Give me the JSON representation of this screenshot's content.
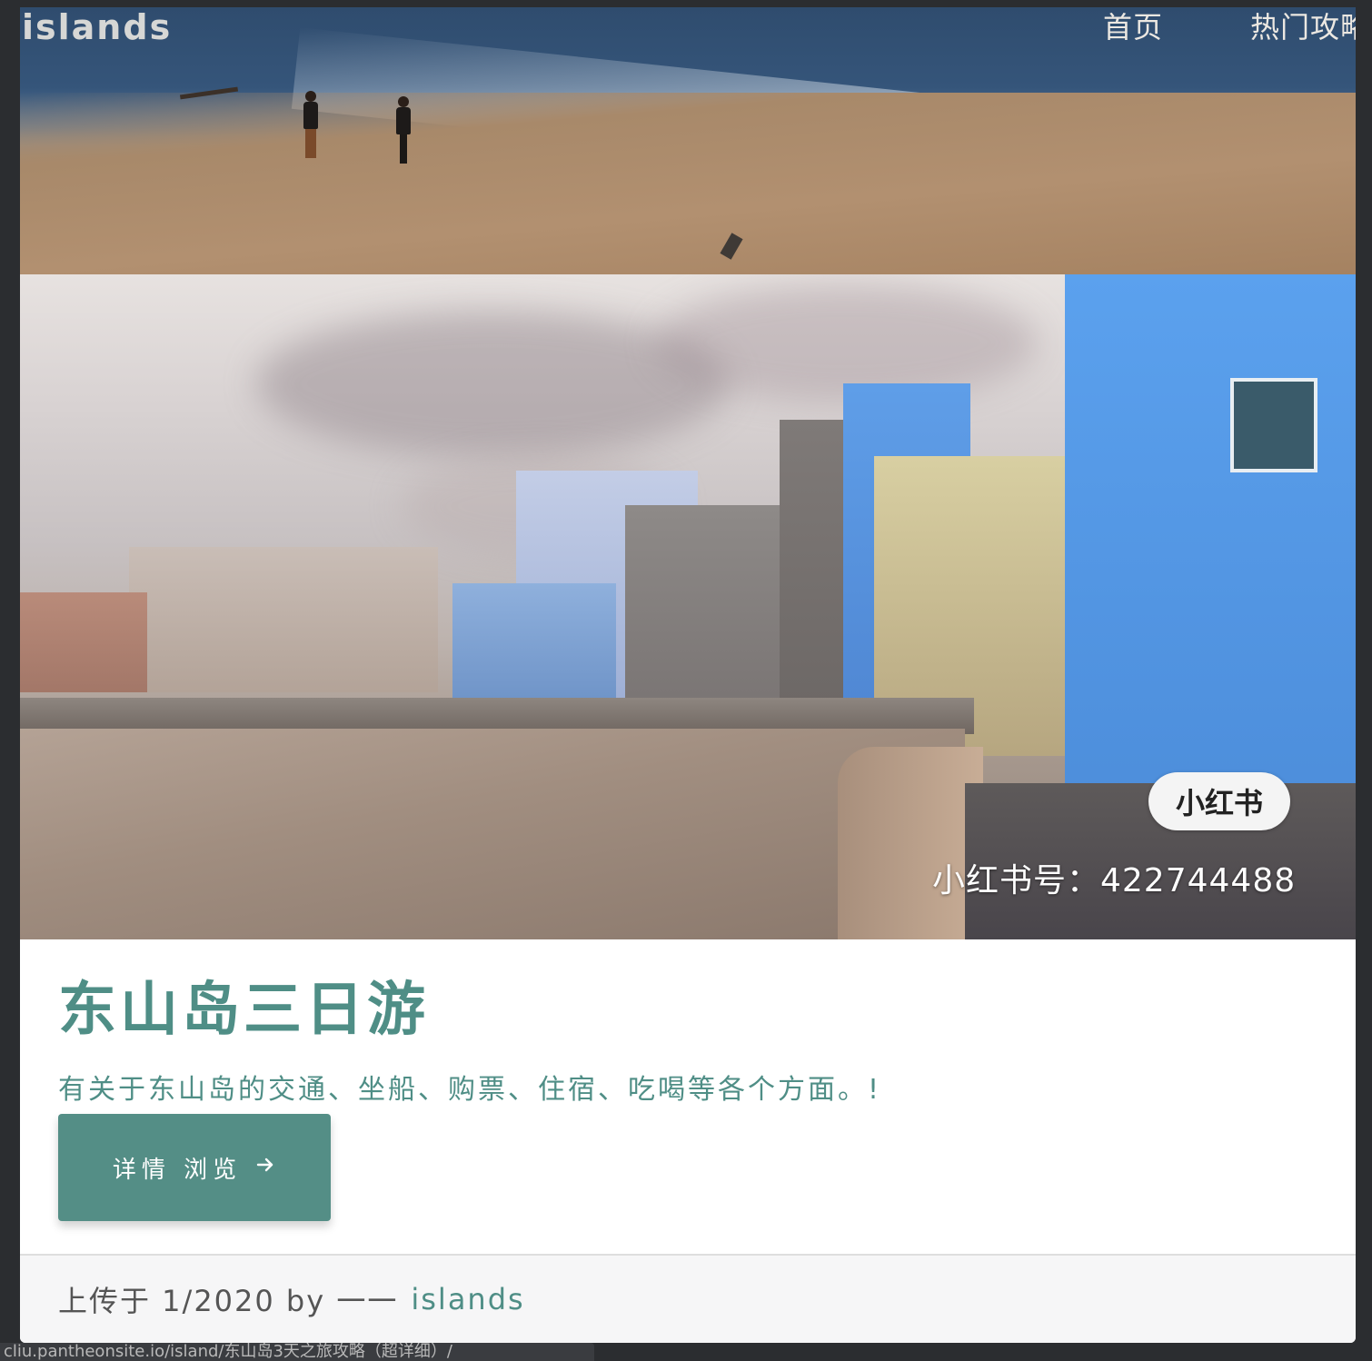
{
  "brand": "islands",
  "nav": [
    {
      "label": "首页"
    },
    {
      "label": "热门攻略"
    }
  ],
  "card": {
    "image_badge": "小红书",
    "image_watermark": "小红书号：422744488",
    "title": "东山岛三日游",
    "description": "有关于东山岛的交通、坐船、购票、住宿、吃喝等各个方面。!",
    "button_label": "详情 浏览",
    "button_icon": "arrow-right-icon",
    "footer_prefix": "上传于 1/2020 by 一一",
    "footer_author": "islands"
  },
  "status_url": "cliu.pantheonsite.io/island/东山岛3天之旅攻略（超详细）/",
  "colors": {
    "accent": "#548e86",
    "title": "#4f8e86"
  }
}
